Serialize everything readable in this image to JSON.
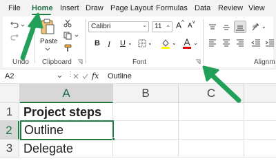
{
  "menu": {
    "tabs": [
      {
        "label": "File"
      },
      {
        "label": "Home",
        "active": true
      },
      {
        "label": "Insert"
      },
      {
        "label": "Draw"
      },
      {
        "label": "Page Layout"
      },
      {
        "label": "Formulas"
      },
      {
        "label": "Data"
      },
      {
        "label": "Review"
      },
      {
        "label": "View"
      }
    ]
  },
  "ribbon": {
    "undo_group_label": "Undo",
    "clipboard_group_label": "Clipboard",
    "paste_label": "Paste",
    "font_group_label": "Font",
    "alignment_group_label": "Alignm",
    "font_name": "Calibri",
    "font_size": "11",
    "bold": "B",
    "italic": "I",
    "underline": "U",
    "grow_font": "A",
    "shrink_font": "A",
    "fill_color": "#ffff00",
    "font_color": "#e00000"
  },
  "formula_bar": {
    "name_box": "A2",
    "fx": "fx",
    "value": "Outline"
  },
  "sheet": {
    "columns": [
      "A",
      "B",
      "C"
    ],
    "rows": [
      {
        "num": "1",
        "a": "Project steps"
      },
      {
        "num": "2",
        "a": "Outline"
      },
      {
        "num": "3",
        "a": "Delegate"
      }
    ]
  },
  "colors": {
    "accent_green": "#1f7a44",
    "arrow_green": "#21a35a"
  }
}
